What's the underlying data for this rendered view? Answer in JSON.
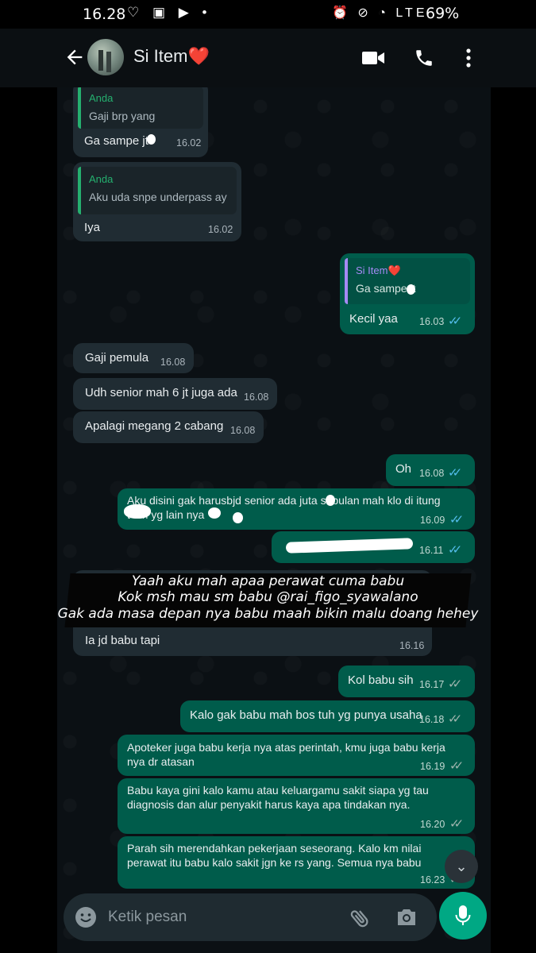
{
  "status_bar": {
    "time": "16.28",
    "left_icons": "♡ ▣ ▶ •",
    "right_icons": "⏰ ⊘ ◔ LTE",
    "battery": "69%"
  },
  "header": {
    "contact_name": "Si Item❤️",
    "icons": [
      "back-arrow-icon",
      "video-call-icon",
      "voice-call-icon",
      "menu-icon"
    ]
  },
  "messages": [
    {
      "dir": "in",
      "quote_author": "Anda",
      "quote_text": "Gaji brp yang",
      "text": "Ga sampe  jt",
      "time": "16.02"
    },
    {
      "dir": "in",
      "quote_author": "Anda",
      "quote_text": "Aku uda snpe underpass ay",
      "text": "Iya",
      "time": "16.02"
    },
    {
      "dir": "out",
      "quote_author": "Si Item❤️",
      "quote_text": "Ga sampe  jt",
      "text": "Kecil yaa",
      "time": "16.03"
    },
    {
      "dir": "in",
      "text": "Gaji pemula",
      "time": "16.08"
    },
    {
      "dir": "in",
      "text": "Udh senior mah 6 jt juga ada",
      "time": "16.08"
    },
    {
      "dir": "in",
      "text": "Apalagi megang 2 cabang",
      "time": "16.08"
    },
    {
      "dir": "out",
      "text": "Oh",
      "time": "16.08"
    },
    {
      "dir": "out",
      "text_line1": "Aku disini gak harusbjd senior ada  juta sebulan mah klo di itung",
      "text_line2": "  t sm   yg lain nya",
      "time": "16.09"
    },
    {
      "dir": "out",
      "text": "",
      "time": "16.11"
    },
    {
      "dir": "in",
      "text": "Ia jd babu tapi",
      "time": "16.16"
    },
    {
      "dir": "out",
      "text": "Kol babu sih",
      "time": "16.17"
    },
    {
      "dir": "out",
      "text": "Kalo gak babu mah bos tuh yg punya usaha",
      "time": "16.18"
    },
    {
      "dir": "out",
      "text_line1": "Apoteker juga babu kerja nya atas perintah, kmu juga babu kerja",
      "text_line2": "nya dr atasan",
      "time": "16.19"
    },
    {
      "dir": "out",
      "text_line1": "Babu kaya gini kalo kamu atau keluargamu sakit siapa yg tau",
      "text_line2": "diagnosis dan alur penyakit harus kaya apa tindakan nya.",
      "time": "16.20"
    },
    {
      "dir": "out",
      "text_line1": "Parah sih merendahkan pekerjaan seseorang. Kalo km nilai",
      "text_line2": "perawat itu babu kalo sakit jgn ke rs yang. Semua nya babu",
      "time": "16.23"
    }
  ],
  "overlay_caption": [
    "Yaah aku mah apaa perawat cuma babu",
    "Kok msh mau sm babu @rai_figo_syawalano",
    "Gak ada masa depan nya babu maah bikin malu doang hehey"
  ],
  "input": {
    "placeholder": "Ketik pesan",
    "icons": [
      "emoji-icon",
      "attach-icon",
      "camera-icon",
      "mic-icon"
    ]
  },
  "colors": {
    "incoming_bubble": "#202c33",
    "outgoing_bubble": "#005c4b",
    "read_ticks": "#53bdeb",
    "quote_anda": "#25b06f",
    "quote_si_item": "#a58af5",
    "accent": "#00a884"
  }
}
